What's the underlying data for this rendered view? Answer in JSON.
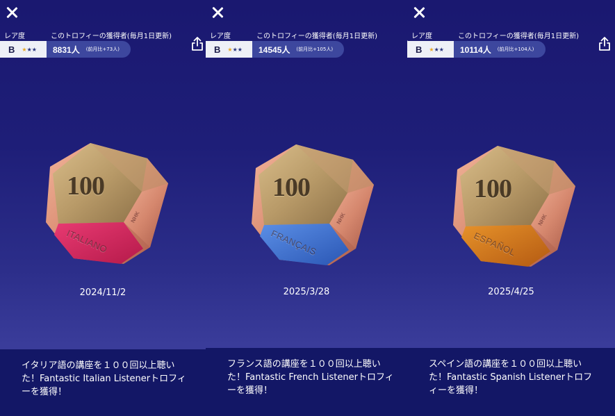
{
  "labels": {
    "rarity": "レア度",
    "holders": "このトロフィーの獲得者(毎月1日更新)"
  },
  "panels": [
    {
      "grade": "B",
      "stars_filled": "★",
      "stars_empty": "★★",
      "count": "8831人",
      "delta": "(前月比+73人)",
      "badge_number": "100",
      "badge_language": "ITALIANO",
      "badge_mark": "NHK",
      "badge_color": "#d9245c",
      "date": "2024/11/2",
      "description": "イタリア語の講座を１００回以上聴いた！Fantastic Italian Listenerトロフィーを獲得！"
    },
    {
      "grade": "B",
      "stars_filled": "★",
      "stars_empty": "★★",
      "count": "14545人",
      "delta": "(前月比+105人)",
      "badge_number": "100",
      "badge_language": "FRANÇAIS",
      "badge_mark": "NHK",
      "badge_color": "#3b6fd0",
      "date": "2025/3/28",
      "description": "フランス語の講座を１００回以上聴いた！Fantastic French Listenerトロフィーを獲得！"
    },
    {
      "grade": "B",
      "stars_filled": "★",
      "stars_empty": "★★",
      "count": "10114人",
      "delta": "(前月比+104人)",
      "badge_number": "100",
      "badge_language": "ESPAÑOL",
      "badge_mark": "NHK",
      "badge_color": "#d8741c",
      "date": "2025/4/25",
      "description": "スペイン語の講座を１００回以上聴いた！Fantastic Spanish Listenerトロフィーを獲得！"
    }
  ],
  "icons": {
    "close": "close-icon",
    "share": "share-icon",
    "star": "star-icon"
  },
  "colors": {
    "background": "#1a1870",
    "footer": "#131766",
    "count_pill": "#3d479e",
    "star_gold": "#e7a824",
    "star_navy": "#25307a",
    "copper": "#d88a70",
    "gold": "#b89a68"
  }
}
